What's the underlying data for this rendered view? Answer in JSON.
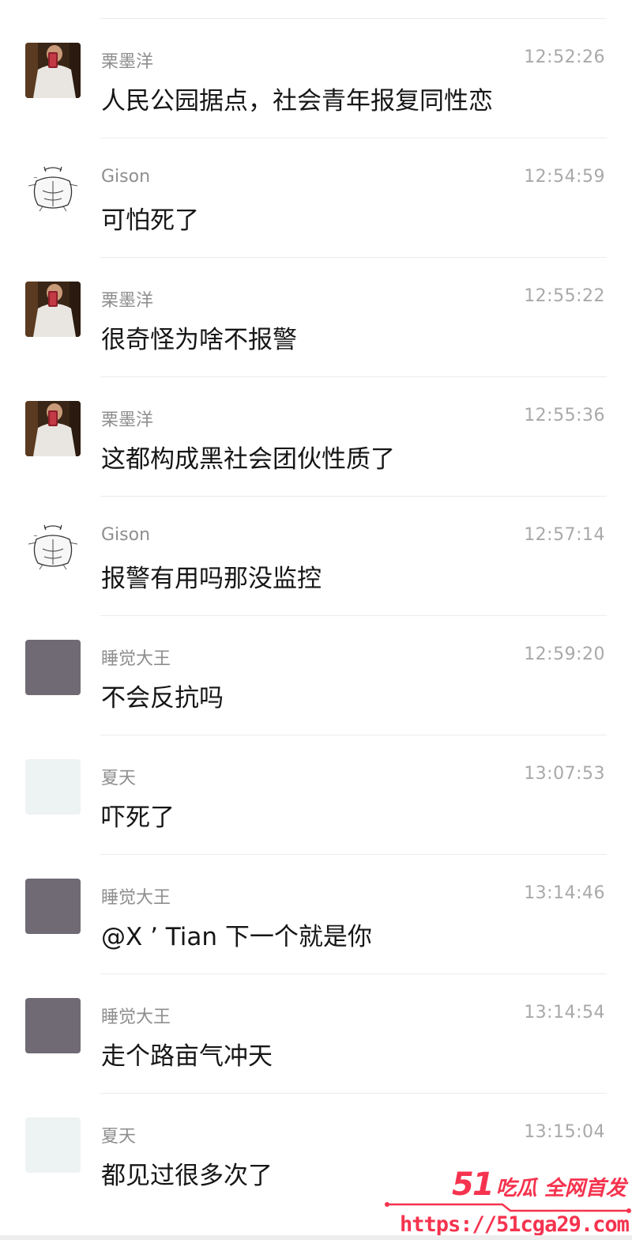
{
  "messages": [
    {
      "sender": "栗墨洋",
      "time": "12:52:26",
      "text": "人民公园据点，社会青年报复同性恋",
      "avatar": "photo"
    },
    {
      "sender": "Gison",
      "time": "12:54:59",
      "text": "可怕死了",
      "avatar": "sketch"
    },
    {
      "sender": "栗墨洋",
      "time": "12:55:22",
      "text": "很奇怪为啥不报警",
      "avatar": "photo"
    },
    {
      "sender": "栗墨洋",
      "time": "12:55:36",
      "text": "这都构成黑社会团伙性质了",
      "avatar": "photo"
    },
    {
      "sender": "Gison",
      "time": "12:57:14",
      "text": "报警有用吗那没监控",
      "avatar": "sketch"
    },
    {
      "sender": "睡觉大王",
      "time": "12:59:20",
      "text": "不会反抗吗",
      "avatar": "gray"
    },
    {
      "sender": "夏天",
      "time": "13:07:53",
      "text": "吓死了",
      "avatar": "pale"
    },
    {
      "sender": "睡觉大王",
      "time": "13:14:46",
      "text": "@X ’ Tian 下一个就是你",
      "avatar": "gray"
    },
    {
      "sender": "睡觉大王",
      "time": "13:14:54",
      "text": "走个路亩气冲天",
      "avatar": "gray"
    },
    {
      "sender": "夏天",
      "time": "13:15:04",
      "text": "都见过很多次了",
      "avatar": "pale"
    }
  ],
  "watermark": {
    "number": "51",
    "slogan": "吃瓜 全网首发",
    "url": "https://51cga29.com",
    "color": "#f5334e"
  }
}
